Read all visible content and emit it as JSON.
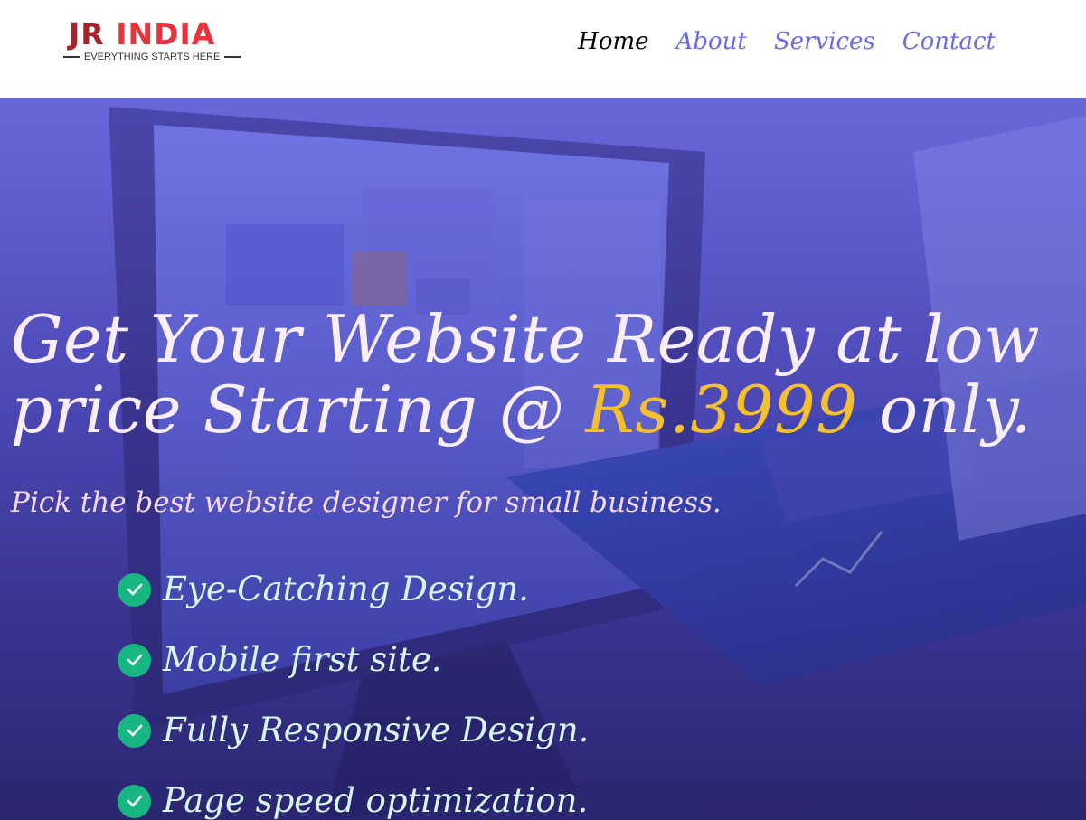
{
  "logo": {
    "word_part1": "JR ",
    "word_part2": "INDIA",
    "tagline": "EVERYTHING STARTS HERE",
    "colors": {
      "dark_red": "#a4232b",
      "bright_red": "#e8333d"
    }
  },
  "nav": {
    "items": [
      {
        "label": "Home",
        "active": true
      },
      {
        "label": "About",
        "active": false
      },
      {
        "label": "Services",
        "active": false
      },
      {
        "label": "Contact",
        "active": false
      }
    ],
    "colors": {
      "active": "#000000",
      "link": "#6a6ae6"
    }
  },
  "hero": {
    "headline_before": "Get Your Website Ready at low price Starting @ ",
    "headline_price": "Rs.3999",
    "headline_after": " only.",
    "subheadline": "Pick the best website designer for small business.",
    "features": [
      "Eye-Catching Design.",
      "Mobile first site.",
      "Fully Responsive Design.",
      "Page speed optimization."
    ],
    "feature_icon": "check-circle-icon",
    "colors": {
      "headline": "#fbeef8",
      "price": "#f5c030",
      "subheadline": "#f7d9ee",
      "feature_text": "#d6f6f4",
      "check_bg": "#17b683",
      "hero_bg": "#4d4ab8"
    }
  }
}
